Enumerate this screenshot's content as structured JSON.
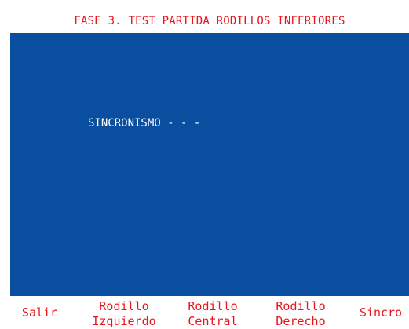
{
  "title": "FASE 3. TEST PARTIDA RODILLOS INFERIORES",
  "status": {
    "text": "SINCRONISMO - - -"
  },
  "function_keys": [
    {
      "lines": [
        "Salir"
      ]
    },
    {
      "lines": [
        "Rodillo",
        "Izquierdo"
      ]
    },
    {
      "lines": [
        "Rodillo",
        "Central"
      ]
    },
    {
      "lines": [
        "Rodillo",
        "Derecho"
      ]
    },
    {
      "lines": [
        "Sincro"
      ]
    }
  ],
  "colors": {
    "panel": "#0a4ea0",
    "accent_text": "#e8141b",
    "status_text": "#ffffff"
  }
}
